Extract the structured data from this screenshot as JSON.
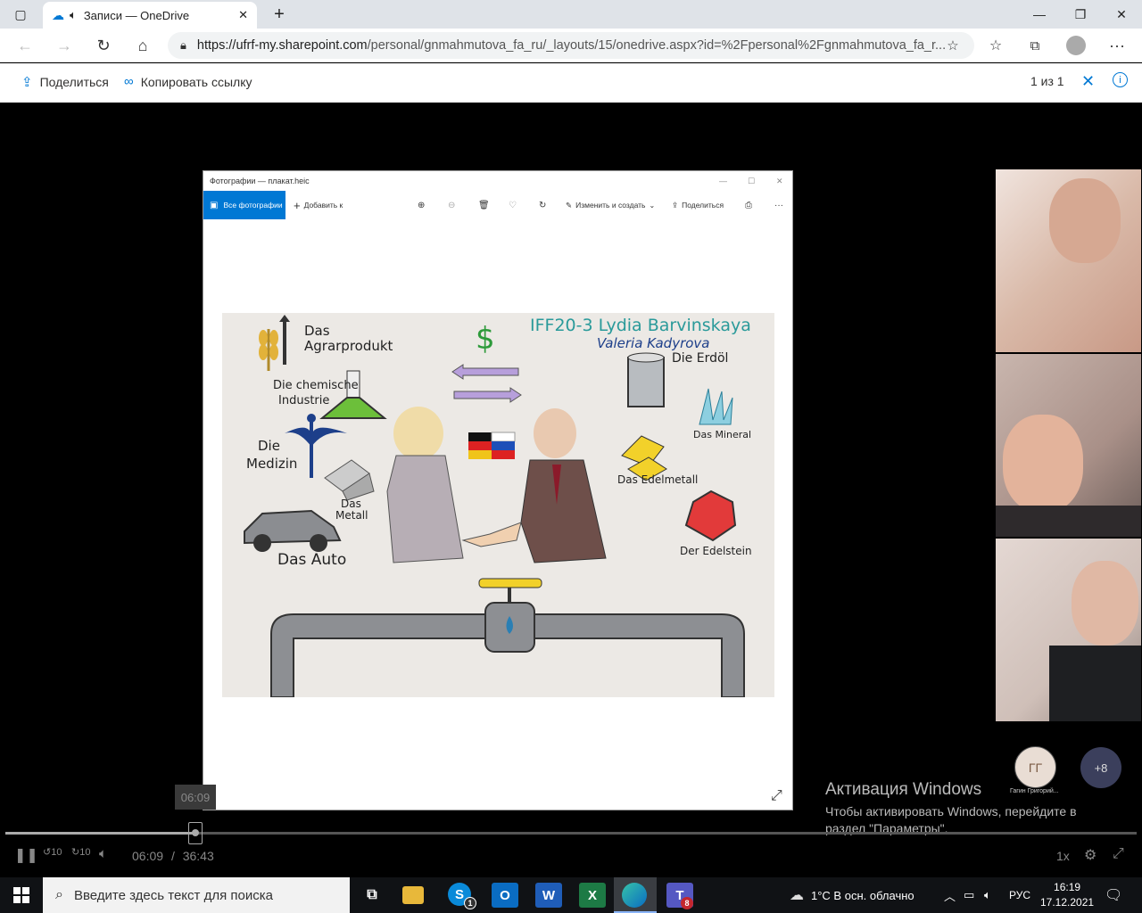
{
  "browser": {
    "tab_title": "Записи — OneDrive",
    "url_host": "https://ufrf-my.sharepoint.com",
    "url_path": "/personal/gnmahmutova_fa_ru/_layouts/15/onedrive.aspx?id=%2Fpersonal%2Fgnmahmutova_fa_r..."
  },
  "onedrive": {
    "share_label": "Поделиться",
    "copy_link_label": "Копировать ссылку",
    "counter": "1 из 1"
  },
  "photos_app": {
    "window_title": "Фотографии — плакат.heic",
    "all_photos": "Все фотографии",
    "add_to": "Добавить к",
    "edit_create": "Изменить и создать",
    "share": "Поделиться"
  },
  "poster": {
    "author1": "IFF20-3 Lydia Barvinskaya",
    "author2": "Valeria Kadyrova",
    "labels": {
      "agrar": "Das Agrarprodukt",
      "chemie1": "Die chemische",
      "chemie2": "Industrie",
      "medizin1": "Die",
      "medizin2": "Medizin",
      "metall1": "Das",
      "metall2": "Metall",
      "auto": "Das Auto",
      "erdol": "Die Erdöl",
      "mineral": "Das Mineral",
      "edelmetall": "Das Edelmetall",
      "edelstein": "Der Edelstein",
      "dollar": "$"
    }
  },
  "participants": {
    "named_initials": "ГГ",
    "named_label": "Гагин Григорий...",
    "more_count": "+8"
  },
  "activation": {
    "title": "Активация Windows",
    "line1": "Чтобы активировать Windows, перейдите в",
    "line2": "раздел \"Параметры\"."
  },
  "player": {
    "tooltip_time": "06:09",
    "current_time": "06:09",
    "separator": "/",
    "total_time": "36:43",
    "speed": "1x",
    "skip_back": "10",
    "skip_forward": "10",
    "progress_fraction": 0.167
  },
  "taskbar": {
    "search_placeholder": "Введите здесь текст для поиска",
    "weather": "1°C  В осн. облачно",
    "language": "РУС",
    "time": "16:19",
    "date": "17.12.2021",
    "skype_badge": "1",
    "teams_badge": "8"
  },
  "colors": {
    "accent": "#0078d4",
    "black_bg": "#000000",
    "taskbar": "#101215"
  }
}
